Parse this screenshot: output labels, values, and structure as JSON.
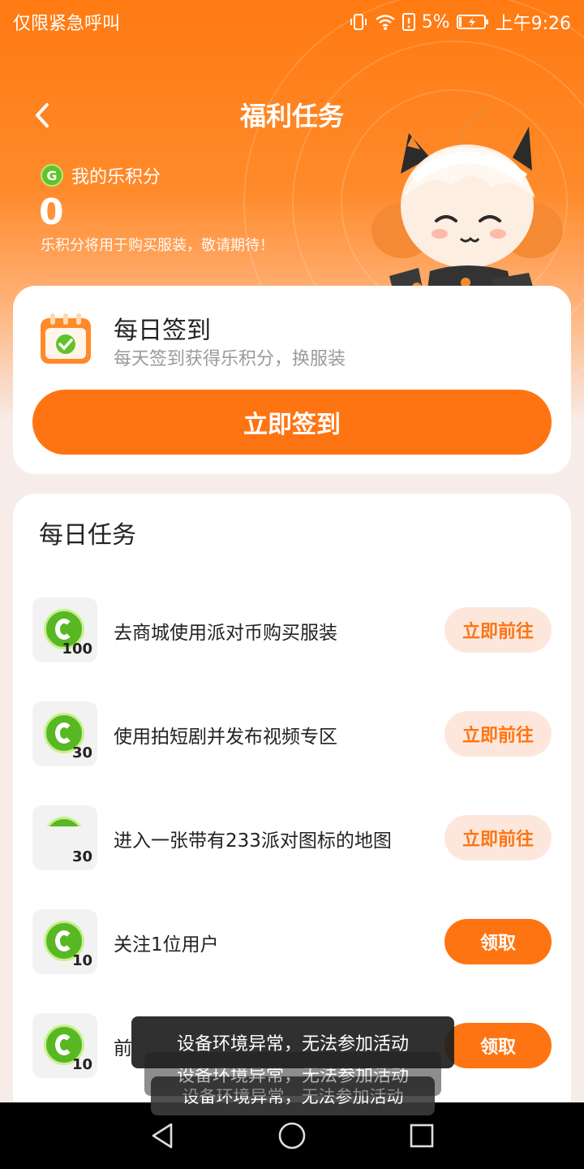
{
  "status_bar": {
    "emergency_text": "仅限紧急呼叫",
    "battery": "5%",
    "time": "上午9:26"
  },
  "header": {
    "title": "福利任务",
    "back_icon": "chevron-left-icon"
  },
  "points": {
    "label": "我的乐积分",
    "value": "0",
    "note": "乐积分将用于购买服装，敬请期待！"
  },
  "checkin": {
    "title": "每日签到",
    "subtitle": "每天签到获得乐积分，换服装",
    "button_label": "立即签到"
  },
  "daily_tasks": {
    "title": "每日任务",
    "items": [
      {
        "label": "去商城使用派对币购买服装",
        "reward": "100",
        "button": "立即前往",
        "button_style": "go"
      },
      {
        "label": "使用拍短剧并发布视频专区",
        "reward": "30",
        "button": "立即前往",
        "button_style": "go"
      },
      {
        "label": "进入一张带有233派对图标的地图",
        "reward": "30",
        "button": "立即前往",
        "button_style": "go"
      },
      {
        "label": "关注1位用户",
        "reward": "10",
        "button": "领取",
        "button_style": "claim"
      },
      {
        "label": "前",
        "reward": "10",
        "button": "领取",
        "button_style": "claim"
      }
    ]
  },
  "toasts": [
    "设备环境异常，无法参加活动",
    "设备环境异常，无法参加活动",
    "设备环境异常，无法参加活动"
  ],
  "nav_bar": {
    "back_icon": "triangle-back-icon",
    "home_icon": "circle-home-icon",
    "recents_icon": "square-recents-icon"
  },
  "colors": {
    "brand_orange": "#ff7412",
    "coin_green": "#58b824",
    "go_button_bg": "#fde7dc"
  }
}
